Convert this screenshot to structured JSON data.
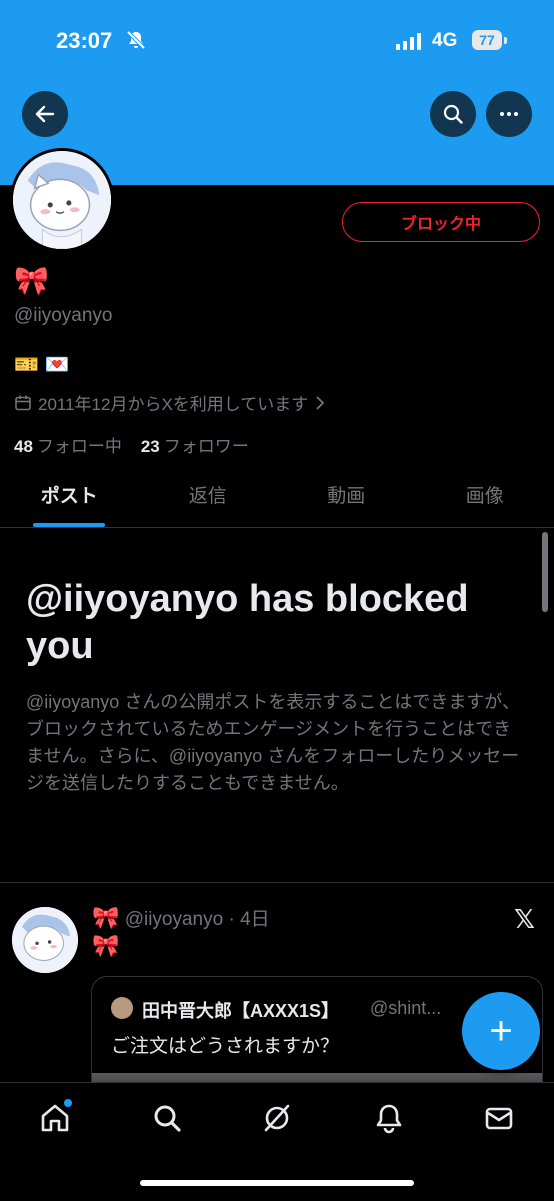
{
  "status_bar": {
    "time": "23:07",
    "network": "4G",
    "battery": "77"
  },
  "header": {
    "back_icon": "arrow-left-icon",
    "search_icon": "search-icon",
    "more_icon": "more-icon"
  },
  "profile": {
    "name": "🎀",
    "handle": "@iiyoyanyo",
    "bio": "🎫 💌",
    "joined": "2011年12月からXを利用しています",
    "following_count": "48",
    "following_label": "フォロー中",
    "followers_count": "23",
    "followers_label": "フォロワー",
    "block_button": "ブロック中"
  },
  "tabs": [
    "ポスト",
    "返信",
    "動画",
    "画像"
  ],
  "blocked_notice": {
    "title": "@iiyoyanyo has blocked you",
    "body": "@iiyoyanyo さんの公開ポストを表示することはできますが、ブロックされているためエンゲージメントを行うことはできません。さらに、@iiyoyanyo さんをフォローしたりメッセージを送信したりすることもできません。"
  },
  "post": {
    "author_emoji": "🎀",
    "handle": "@iiyoyanyo",
    "time": "· 4日",
    "text": "🎀",
    "quote": {
      "name": "田中晋大郎【AXXX1S】",
      "handle": "@shint...",
      "text": "ご注文はどうされますか？"
    }
  },
  "fab_label": "+",
  "colors": {
    "accent": "#1d9bf0",
    "danger": "#f4212e",
    "muted": "#71767b"
  }
}
